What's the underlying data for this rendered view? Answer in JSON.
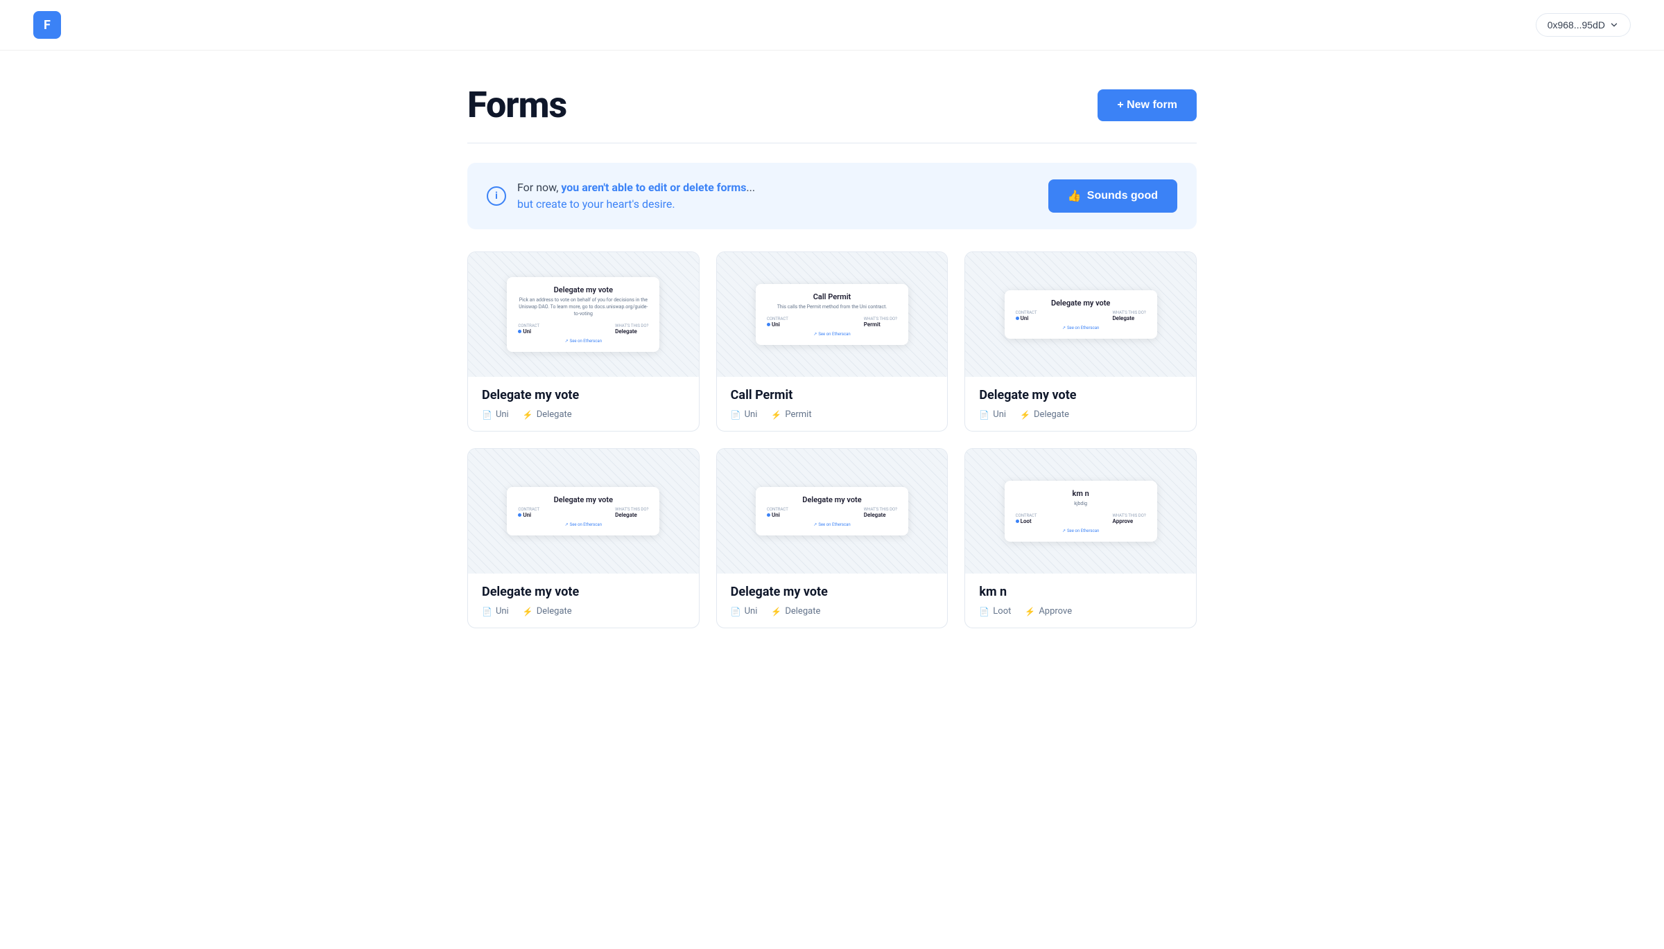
{
  "header": {
    "logo_letter": "F",
    "wallet_address": "0x968...95dD",
    "chevron": "▾"
  },
  "page": {
    "title": "Forms",
    "new_form_button": "+ New form",
    "info_banner": {
      "info_char": "i",
      "message_part1": "For now, ",
      "message_bold": "you aren't able to edit or delete forms",
      "message_part2": "...",
      "message_line2": "but create to your heart's desire.",
      "dismiss_button": "👍  Sounds good"
    }
  },
  "cards": [
    {
      "id": 1,
      "title": "Delegate my vote",
      "mini_title": "Delegate my vote",
      "mini_desc": "Pick an address to vote on behalf of you for decisions in the Uniswap DAO. To learn more, go to docs.uniswap.org/guide-to-voting",
      "contract_label": "CONTRACT",
      "contract_value": "Uni",
      "whatstodo_label": "WHAT'S THIS DO?",
      "whatstodo_value": "Delegate",
      "link_text": "See on Etherscan",
      "meta_contract": "Uni",
      "meta_action": "Delegate"
    },
    {
      "id": 2,
      "title": "Call Permit",
      "mini_title": "Call Permit",
      "mini_desc": "This calls the Permit method from the Uni contract.",
      "contract_label": "CONTRACT",
      "contract_value": "Uni",
      "whatstodo_label": "WHAT'S THIS DO?",
      "whatstodo_value": "Permit",
      "link_text": "See on Etherscan",
      "meta_contract": "Uni",
      "meta_action": "Permit"
    },
    {
      "id": 3,
      "title": "Delegate my vote",
      "mini_title": "Delegate my vote",
      "mini_desc": "",
      "contract_label": "CONTRACT",
      "contract_value": "Uni",
      "whatstodo_label": "WHAT'S THIS DO?",
      "whatstodo_value": "Delegate",
      "link_text": "See on Etherscan",
      "meta_contract": "Uni",
      "meta_action": "Delegate"
    },
    {
      "id": 4,
      "title": "Delegate my vote",
      "mini_title": "Delegate my vote",
      "mini_desc": "",
      "contract_label": "CONTRACT",
      "contract_value": "Uni",
      "whatstodo_label": "WHAT'S THIS DO?",
      "whatstodo_value": "Delegate",
      "link_text": "See on Etherscan",
      "meta_contract": "Uni",
      "meta_action": "Delegate"
    },
    {
      "id": 5,
      "title": "Delegate my vote",
      "mini_title": "Delegate my vote",
      "mini_desc": "",
      "contract_label": "CONTRACT",
      "contract_value": "Uni",
      "whatstodo_label": "WHAT'S THIS DO?",
      "whatstodo_value": "Delegate",
      "link_text": "See on Etherscan",
      "meta_contract": "Uni",
      "meta_action": "Delegate"
    },
    {
      "id": 6,
      "title": "km n",
      "mini_title": "km n",
      "mini_desc": "kjbdig",
      "contract_label": "CONTRACT",
      "contract_value": "Loot",
      "whatstodo_label": "WHAT'S THIS DO?",
      "whatstodo_value": "Approve",
      "link_text": "See on Etherscan",
      "meta_contract": "Loot",
      "meta_action": "Approve"
    }
  ]
}
